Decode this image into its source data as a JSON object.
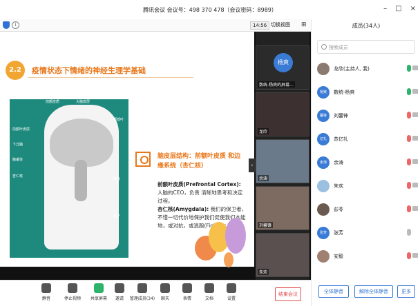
{
  "window": {
    "title": "腾讯会议 会议号：498 370 478（会议密码：8989）",
    "controls": [
      "–",
      "□",
      "×"
    ]
  },
  "topbar": {
    "time": "14:56",
    "switch_view": "切换视图"
  },
  "slide": {
    "number": "2.2",
    "title": "疫情状态下情绪的神经生理学基础",
    "brain_labels": [
      "前额皮质",
      "大脑皮层",
      "额部叶",
      "前额叶皮层",
      "下丘脑",
      "脑垂体",
      "杏仁核",
      "海马",
      "脑干"
    ],
    "heading": "脑皮层结构：前额叶皮质 和边缘系统（杏仁核）",
    "para1_bold": "前额叶皮质(Prefrontal Cortex):",
    "para1_text": " 人脑的CEO，负责 清晰地思考和决定过程。",
    "para2_bold": "杏仁核(Amygdala):",
    "para2_text": " 我们的保卫者，不惜一切代价地保护我们促使我们本能地，或对抗，或逃跑(Fight or Flight)"
  },
  "videos": [
    {
      "name": "数统-杨爽的屏幕...",
      "avatar": "杨爽"
    },
    {
      "name": "龙欣",
      "avatar": ""
    },
    {
      "name": "余涛",
      "avatar": ""
    },
    {
      "name": "刘馨锋",
      "avatar": ""
    },
    {
      "name": "朱欢",
      "avatar": ""
    }
  ],
  "toolbar": {
    "items": [
      "静音",
      "停止视频",
      "共享屏幕",
      "邀请",
      "管理成员(34)",
      "聊天",
      "表情",
      "文档",
      "设置"
    ],
    "end_label": "结束会议"
  },
  "members_panel": {
    "title": "成员(34人)",
    "search_placeholder": "搜索成员",
    "members": [
      {
        "name": "龙欣(主持人, 我)",
        "avatar": "",
        "mic": "on"
      },
      {
        "name": "数统-杨爽",
        "avatar": "杨爽",
        "mic": "on"
      },
      {
        "name": "刘馨锋",
        "avatar": "馨锋",
        "mic": "muted"
      },
      {
        "name": "苏亿礼",
        "avatar": "亿礼",
        "mic": "muted"
      },
      {
        "name": "余涛",
        "avatar": "余涛",
        "mic": "muted"
      },
      {
        "name": "朱欢",
        "avatar": "",
        "mic": "muted"
      },
      {
        "name": "彭苓",
        "avatar": "",
        "mic": "muted"
      },
      {
        "name": "张芳",
        "avatar": "张芳",
        "mic": "off"
      },
      {
        "name": "安毅",
        "avatar": "",
        "mic": "muted"
      }
    ],
    "btn_mute_all": "全体静音",
    "btn_unmute_all": "解除全体静音",
    "btn_more": "更多"
  }
}
